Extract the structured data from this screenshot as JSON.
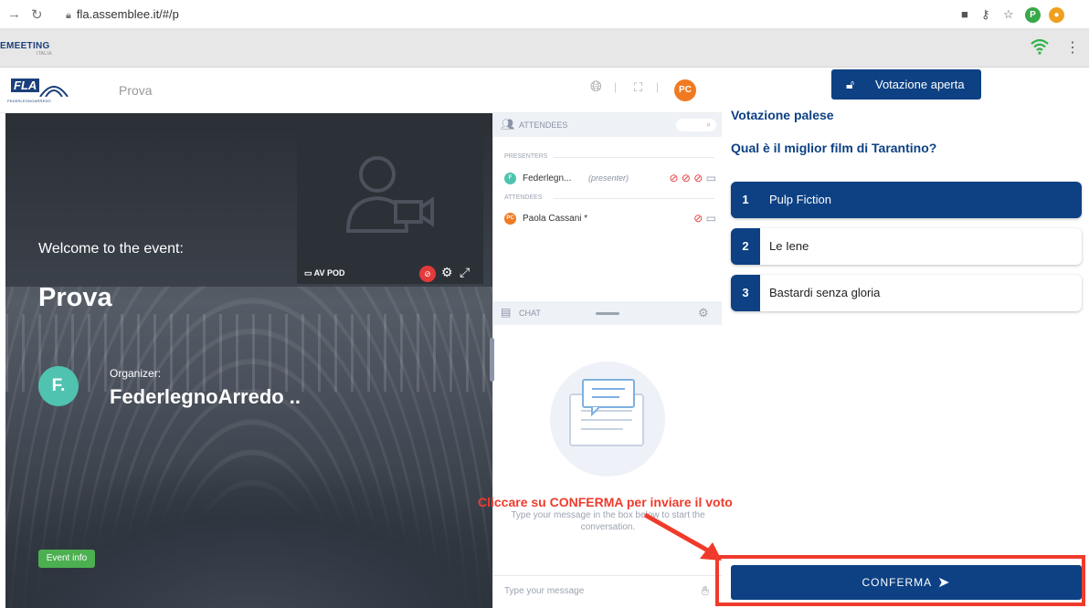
{
  "browser": {
    "url": "fla.assemblee.it/#/p",
    "profile_initial": "P"
  },
  "app": {
    "logo_text": "EMEETING",
    "logo_sub": "ITALIA"
  },
  "event_header": {
    "logo_text": "FLA",
    "logo_tagline": "FEDERLEGNOARREDO",
    "event_name": "Prova",
    "user_initials": "PC"
  },
  "stage": {
    "welcome": "Welcome to the event:",
    "title": "Prova",
    "organizer_initial": "F.",
    "organizer_label": "Organizer:",
    "organizer_name": "FederlegnoArredo ..",
    "event_info_button": "Event info"
  },
  "av_pod": {
    "label": "AV POD"
  },
  "attendees_panel": {
    "title": "ATTENDEES",
    "presenters_label": "PRESENTERS",
    "attendees_label": "ATTENDEES",
    "presenters": [
      {
        "initial": "F",
        "name": "Federlegn...",
        "role": "(presenter)",
        "color": "#4fc3b0"
      }
    ],
    "attendees": [
      {
        "initial": "PC",
        "name": "Paola Cassani *",
        "color": "#f07a22"
      }
    ]
  },
  "chat_panel": {
    "title": "CHAT",
    "empty_hint": "Type your message in the box below to start the conversation.",
    "input_placeholder": "Type your message"
  },
  "voting": {
    "status_button": "Votazione aperta",
    "vote_type": "Votazione palese",
    "question": "Qual è il miglior film di Tarantino?",
    "options": [
      {
        "num": "1",
        "label": "Pulp Fiction",
        "selected": true
      },
      {
        "num": "2",
        "label": "Le Iene",
        "selected": false
      },
      {
        "num": "3",
        "label": "Bastardi senza gloria",
        "selected": false
      }
    ],
    "confirm_button": "CONFERMA"
  },
  "annotation": {
    "text": "Cliccare su CONFERMA per inviare il voto",
    "color": "#f03a2c"
  },
  "colors": {
    "primary": "#0d4184",
    "accent_orange": "#f07a22",
    "organizer_teal": "#4fc3b0",
    "event_info_green": "#4caf50",
    "alert_red": "#e33a3a"
  }
}
